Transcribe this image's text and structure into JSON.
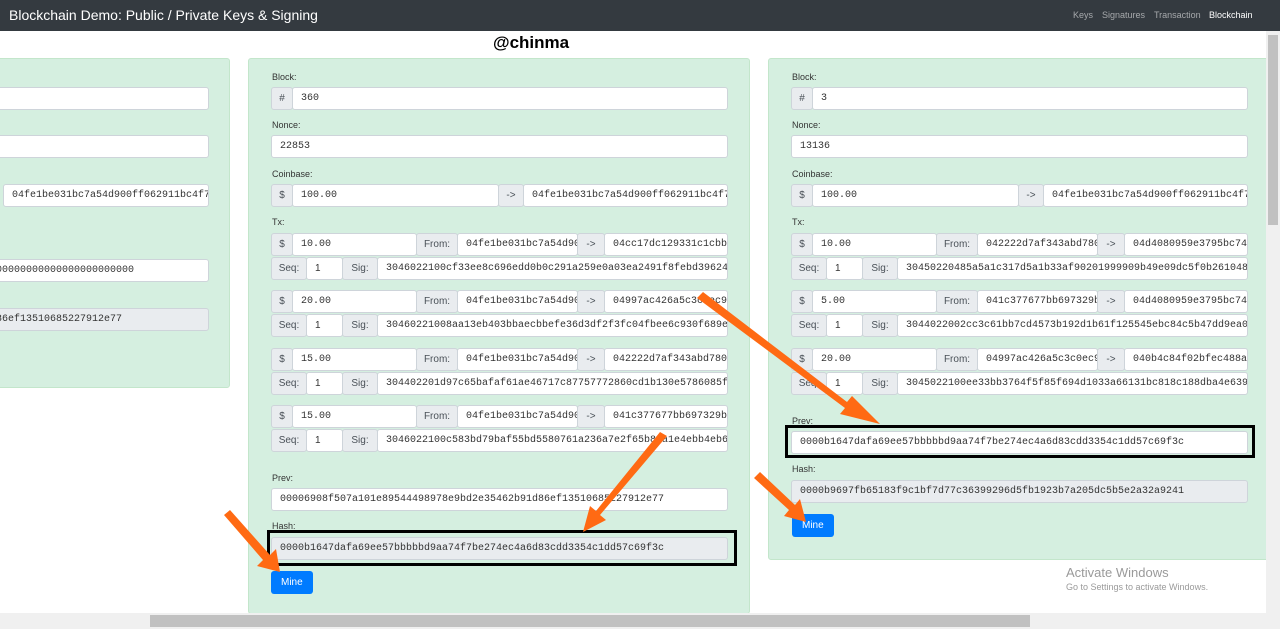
{
  "app_title": "Blockchain Demo: Public / Private Keys & Signing",
  "nav": {
    "keys": "Keys",
    "signatures": "Signatures",
    "transaction": "Transaction",
    "blockchain": "Blockchain"
  },
  "watermark": "@chinma",
  "labels": {
    "block": "Block:",
    "nonce": "Nonce:",
    "coinbase": "Coinbase:",
    "tx": "Tx:",
    "prev": "Prev:",
    "hash": "Hash:",
    "hash_symbol": "#",
    "dollar": "$",
    "arrow": "->",
    "from": "From:",
    "seq": "Seq:",
    "sig": "Sig:",
    "mine": "Mine"
  },
  "left_block": {
    "nonce_fragment": "",
    "coinbase_to": "04fe1be031bc7a54d900ff062911bc4f7b",
    "prev": "000000000000000000000000",
    "hash": "d86ef13510685227912e77"
  },
  "middle_block": {
    "block": "360",
    "nonce": "22853",
    "coinbase_amount": "100.00",
    "coinbase_to": "04fe1be031bc7a54d900ff062911bc4f7b",
    "txs": [
      {
        "amount": "10.00",
        "from": "04fe1be031bc7a54d900",
        "to": "04cc17dc129331c1cbb",
        "seq": "1",
        "sig": "3046022100cf33ee8c696edd0b0c291a259e0a03ea2491f8febd396244e3"
      },
      {
        "amount": "20.00",
        "from": "04fe1be031bc7a54d900",
        "to": "04997ac426a5c3c0ec9",
        "seq": "1",
        "sig": "30460221008aa13eb403bbaecbbefe36d3df2f3fc04fbee6c930f689eef1e"
      },
      {
        "amount": "15.00",
        "from": "04fe1be031bc7a54d900",
        "to": "042222d7af343abd780",
        "seq": "1",
        "sig": "304402201d97c65bafaf61ae46717c87757772860cd1b130e5786085f82be"
      },
      {
        "amount": "15.00",
        "from": "04fe1be031bc7a54d900",
        "to": "041c377677bb697329b",
        "seq": "1",
        "sig": "3046022100c583bd79baf55bd5580761a236a7e2f65b80a1e4ebb4eb620"
      }
    ],
    "prev": "00006908f507a101e89544498978e9bd2e35462b91d86ef13510685227912e77",
    "hash": "0000b1647dafa69ee57bbbbbd9aa74f7be274ec4a6d83cdd3354c1dd57c69f3c"
  },
  "right_block": {
    "block": "3",
    "nonce": "13136",
    "coinbase_amount": "100.00",
    "coinbase_to": "04fe1be031bc7a54d900ff062911bc4f7b",
    "txs": [
      {
        "amount": "10.00",
        "from": "042222d7af343abd780",
        "to": "04d4080959e3795bc74",
        "seq": "1",
        "sig": "30450220485a5a1c317d5a1b33af90201999909b49e09dc5f0b261048bbe"
      },
      {
        "amount": "5.00",
        "from": "041c377677bb697329b",
        "to": "04d4080959e3795bc74",
        "seq": "1",
        "sig": "3044022002cc3c61bb7cd4573b192d1b61f125545ebc84c5b47dd9ea096b"
      },
      {
        "amount": "20.00",
        "from": "04997ac426a5c3c0ec9",
        "to": "040b4c84f02bfec488a",
        "seq": "1",
        "sig": "3045022100ee33bb3764f5f85f694d1033a66131bc818c188dba4e6392e8"
      }
    ],
    "prev": "0000b1647dafa69ee57bbbbbd9aa74f7be274ec4a6d83cdd3354c1dd57c69f3c",
    "hash": "0000b9697fb65183f9c1bf7d77c36399296d5fb1923b7a205dc5b5e2a32a9241"
  },
  "activate_windows": {
    "title": "Activate Windows",
    "subtitle": "Go to Settings to activate Windows."
  },
  "colors": {
    "card": "#d5efe0",
    "navbar": "#343a40",
    "button": "#007bff",
    "arrow": "#ff6a13"
  }
}
